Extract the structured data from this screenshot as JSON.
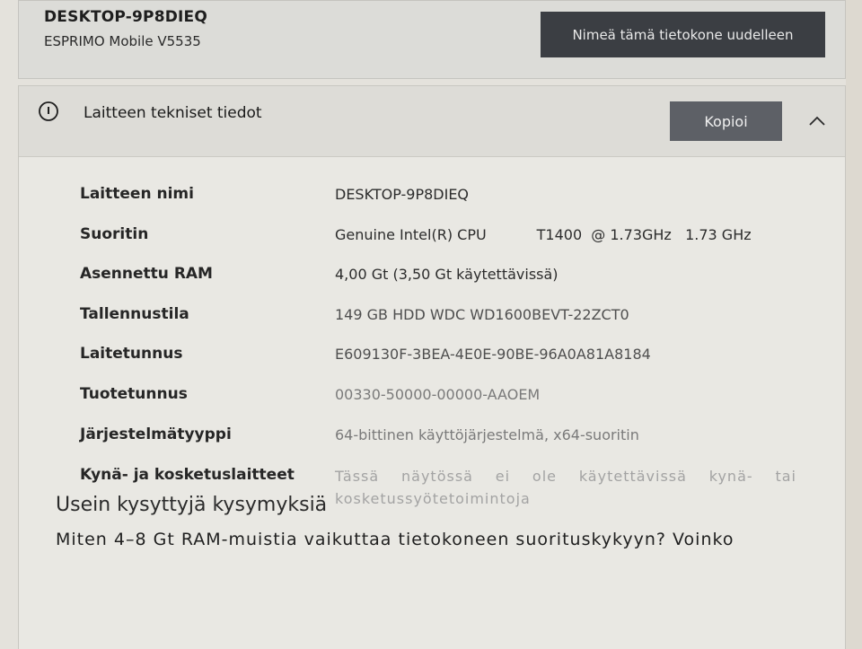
{
  "device": {
    "name": "DESKTOP-9P8DIEQ",
    "model": "ESPRIMO Mobile V5535",
    "rename_label": "Nimeä tämä tietokone uudelleen"
  },
  "specs": {
    "title": "Laitteen tekniset tiedot",
    "copy_label": "Kopioi",
    "icons": {
      "info": "info-circle-icon",
      "collapse": "chevron-up-icon"
    },
    "rows": [
      {
        "label": "Laitteen nimi",
        "value": "DESKTOP-9P8DIEQ"
      },
      {
        "label": "Suoritin",
        "value": "Genuine Intel(R) CPU           T1400  @ 1.73GHz   1.73 GHz"
      },
      {
        "label": "Asennettu RAM",
        "value": "4,00 Gt (3,50 Gt käytettävissä)"
      },
      {
        "label": "Tallennustila",
        "value": "149 GB HDD WDC WD1600BEVT-22ZCT0"
      },
      {
        "label": "Laitetunnus",
        "value": "E609130F-3BEA-4E0E-90BE-96A0A81A8184"
      },
      {
        "label": "Tuotetunnus",
        "value": "00330-50000-00000-AAOEM"
      },
      {
        "label": "Järjestelmätyyppi",
        "value": "64-bittinen käyttöjärjestelmä, x64-suoritin"
      },
      {
        "label": "Kynä- ja kosketuslaitteet",
        "value": "Tässä näytössä ei ole käytettävissä kynä- tai kosketussyötetoimintoja"
      }
    ]
  },
  "faq": {
    "title": "Usein kysyttyjä kysymyksiä",
    "question": "Miten 4–8 Gt RAM-muistia vaikuttaa tietokoneen suorituskykyyn? Voinko"
  },
  "colors": {
    "background": "#e4e2dc",
    "rename_button": "#3b3e43",
    "copy_button": "#5d6066",
    "header_strip": "#dddcd7"
  }
}
